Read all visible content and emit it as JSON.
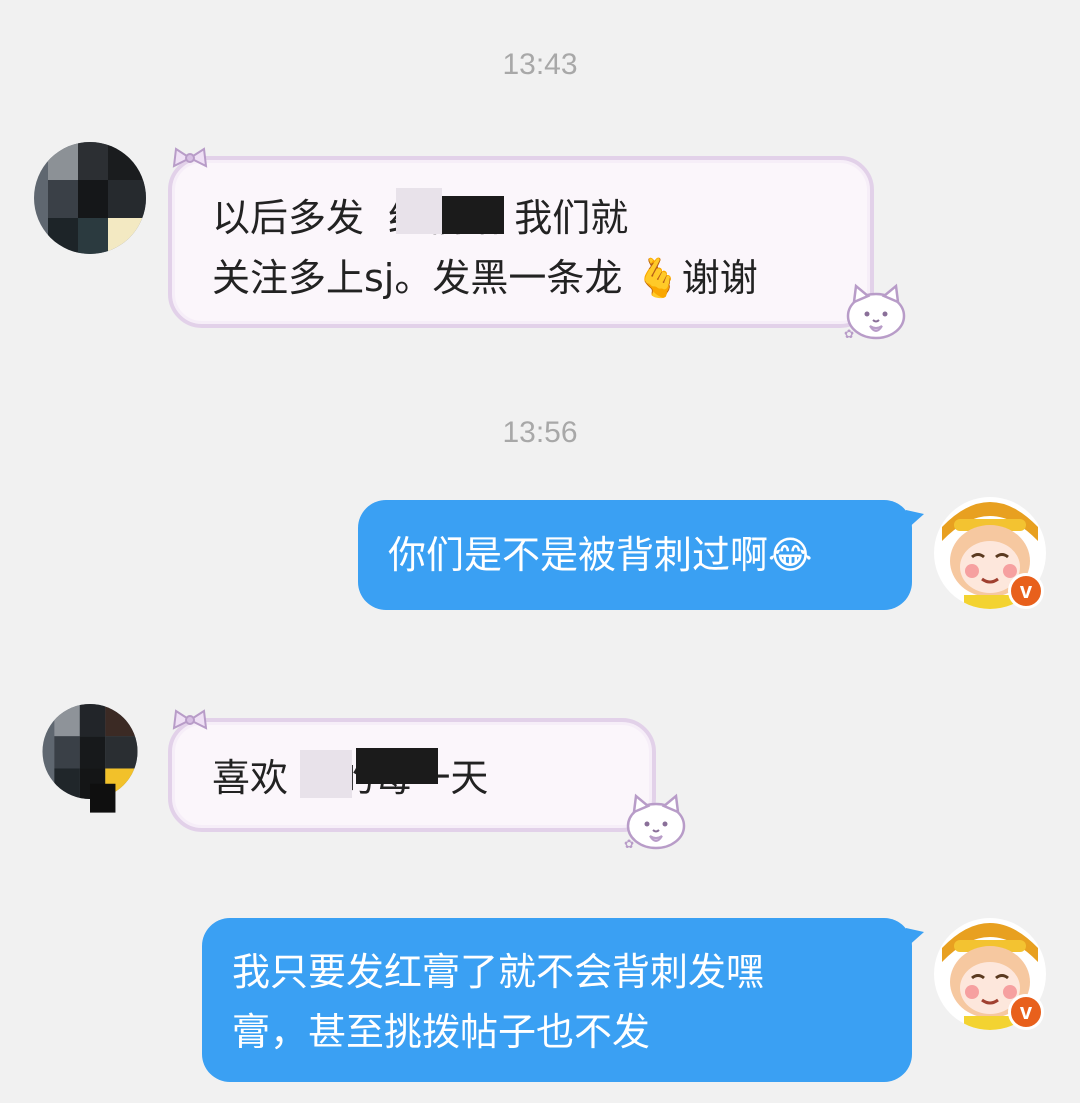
{
  "timestamps": [
    "13:43",
    "13:56"
  ],
  "messages": [
    {
      "side": "incoming",
      "text": "以后多发  红稿哈 我们就\n关注多上sj。发黑一条龙 🫰谢谢"
    },
    {
      "side": "outgoing",
      "text": "你们是不是被背刺过啊😂"
    },
    {
      "side": "incoming",
      "text": "喜欢    的每一天"
    },
    {
      "side": "outgoing",
      "text": "我只要发红膏了就不会背刺发嘿\n膏，甚至挑拨帖子也不发"
    }
  ],
  "avatar_badge": "v",
  "colors": {
    "outgoing_bubble": "#3aa0f3",
    "incoming_bubble": "#fbf6fb",
    "incoming_border": "#e2d1e9",
    "badge": "#e8601c"
  }
}
